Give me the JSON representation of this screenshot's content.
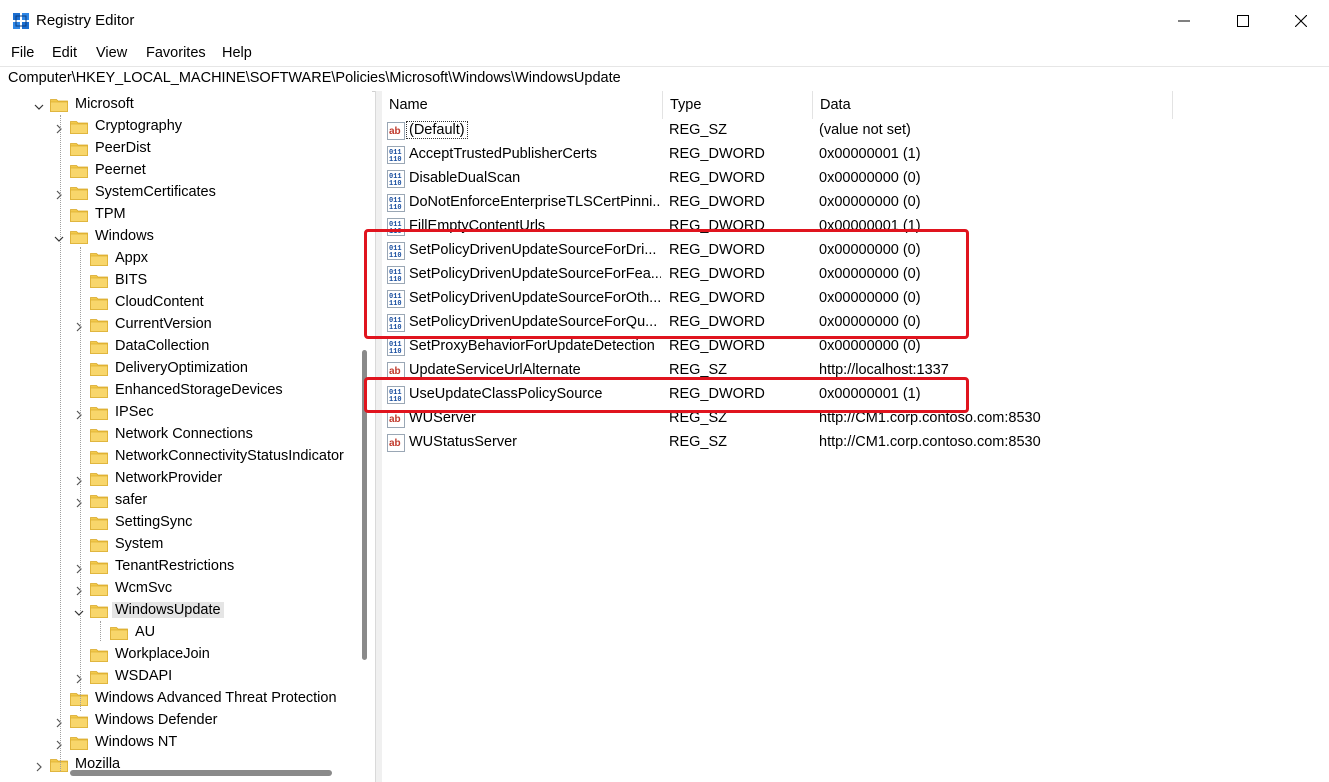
{
  "window": {
    "title": "Registry Editor"
  },
  "menu": [
    "File",
    "Edit",
    "View",
    "Favorites",
    "Help"
  ],
  "address": "Computer\\HKEY_LOCAL_MACHINE\\SOFTWARE\\Policies\\Microsoft\\Windows\\WindowsUpdate",
  "tree": [
    {
      "label": "Microsoft",
      "level": 0,
      "expander": "open"
    },
    {
      "label": "Cryptography",
      "level": 1,
      "expander": "closed"
    },
    {
      "label": "PeerDist",
      "level": 1,
      "expander": "none"
    },
    {
      "label": "Peernet",
      "level": 1,
      "expander": "none"
    },
    {
      "label": "SystemCertificates",
      "level": 1,
      "expander": "closed"
    },
    {
      "label": "TPM",
      "level": 1,
      "expander": "none"
    },
    {
      "label": "Windows",
      "level": 1,
      "expander": "open"
    },
    {
      "label": "Appx",
      "level": 2,
      "expander": "none"
    },
    {
      "label": "BITS",
      "level": 2,
      "expander": "none"
    },
    {
      "label": "CloudContent",
      "level": 2,
      "expander": "none"
    },
    {
      "label": "CurrentVersion",
      "level": 2,
      "expander": "closed"
    },
    {
      "label": "DataCollection",
      "level": 2,
      "expander": "none"
    },
    {
      "label": "DeliveryOptimization",
      "level": 2,
      "expander": "none"
    },
    {
      "label": "EnhancedStorageDevices",
      "level": 2,
      "expander": "none"
    },
    {
      "label": "IPSec",
      "level": 2,
      "expander": "closed"
    },
    {
      "label": "Network Connections",
      "level": 2,
      "expander": "none"
    },
    {
      "label": "NetworkConnectivityStatusIndicator",
      "level": 2,
      "expander": "none"
    },
    {
      "label": "NetworkProvider",
      "level": 2,
      "expander": "closed"
    },
    {
      "label": "safer",
      "level": 2,
      "expander": "closed"
    },
    {
      "label": "SettingSync",
      "level": 2,
      "expander": "none"
    },
    {
      "label": "System",
      "level": 2,
      "expander": "none"
    },
    {
      "label": "TenantRestrictions",
      "level": 2,
      "expander": "closed"
    },
    {
      "label": "WcmSvc",
      "level": 2,
      "expander": "closed"
    },
    {
      "label": "WindowsUpdate",
      "level": 2,
      "expander": "open",
      "selected": true
    },
    {
      "label": "AU",
      "level": 3,
      "expander": "none"
    },
    {
      "label": "WorkplaceJoin",
      "level": 2,
      "expander": "none"
    },
    {
      "label": "WSDAPI",
      "level": 2,
      "expander": "closed"
    },
    {
      "label": "Windows Advanced Threat Protection",
      "level": 1,
      "expander": "none"
    },
    {
      "label": "Windows Defender",
      "level": 1,
      "expander": "closed"
    },
    {
      "label": "Windows NT",
      "level": 1,
      "expander": "closed"
    },
    {
      "label": "Mozilla",
      "level": 0,
      "expander": "closed"
    }
  ],
  "columns": {
    "name": "Name",
    "type": "Type",
    "data": "Data"
  },
  "values": [
    {
      "name": "(Default)",
      "type": "REG_SZ",
      "data": "(value not set)",
      "icon": "string-value-icon",
      "focused": true
    },
    {
      "name": "AcceptTrustedPublisherCerts",
      "type": "REG_DWORD",
      "data": "0x00000001 (1)",
      "icon": "binary-value-icon"
    },
    {
      "name": "DisableDualScan",
      "type": "REG_DWORD",
      "data": "0x00000000 (0)",
      "icon": "binary-value-icon"
    },
    {
      "name": "DoNotEnforceEnterpriseTLSCertPinni...",
      "type": "REG_DWORD",
      "data": "0x00000000 (0)",
      "icon": "binary-value-icon"
    },
    {
      "name": "FillEmptyContentUrls",
      "type": "REG_DWORD",
      "data": "0x00000001 (1)",
      "icon": "binary-value-icon"
    },
    {
      "name": "SetPolicyDrivenUpdateSourceForDri...",
      "type": "REG_DWORD",
      "data": "0x00000000 (0)",
      "icon": "binary-value-icon"
    },
    {
      "name": "SetPolicyDrivenUpdateSourceForFea...",
      "type": "REG_DWORD",
      "data": "0x00000000 (0)",
      "icon": "binary-value-icon"
    },
    {
      "name": "SetPolicyDrivenUpdateSourceForOth...",
      "type": "REG_DWORD",
      "data": "0x00000000 (0)",
      "icon": "binary-value-icon"
    },
    {
      "name": "SetPolicyDrivenUpdateSourceForQu...",
      "type": "REG_DWORD",
      "data": "0x00000000 (0)",
      "icon": "binary-value-icon"
    },
    {
      "name": "SetProxyBehaviorForUpdateDetection",
      "type": "REG_DWORD",
      "data": "0x00000000 (0)",
      "icon": "binary-value-icon"
    },
    {
      "name": "UpdateServiceUrlAlternate",
      "type": "REG_SZ",
      "data": "http://localhost:1337",
      "icon": "string-value-icon"
    },
    {
      "name": "UseUpdateClassPolicySource",
      "type": "REG_DWORD",
      "data": "0x00000001 (1)",
      "icon": "binary-value-icon"
    },
    {
      "name": "WUServer",
      "type": "REG_SZ",
      "data": "http://CM1.corp.contoso.com:8530",
      "icon": "string-value-icon"
    },
    {
      "name": "WUStatusServer",
      "type": "REG_SZ",
      "data": "http://CM1.corp.contoso.com:8530",
      "icon": "string-value-icon"
    }
  ],
  "highlight_color": "#e0141e",
  "folder_color": "#f2c94c"
}
